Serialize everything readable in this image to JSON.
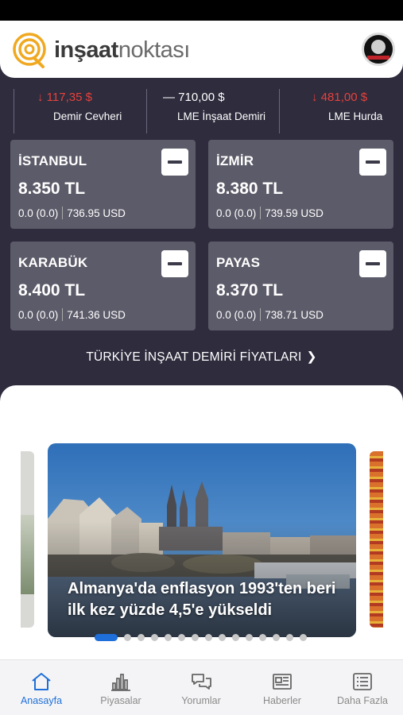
{
  "header": {
    "logo_bold": "inşaat",
    "logo_light": "noktası"
  },
  "ticker": [
    {
      "value": "117,35 $",
      "label": "Demir Cevheri",
      "direction": "down",
      "arrow": "↓"
    },
    {
      "value": "710,00 $",
      "label": "LME İnşaat Demiri",
      "direction": "flat",
      "arrow": "—"
    },
    {
      "value": "481,00 $",
      "label": "LME Hurda",
      "direction": "down",
      "arrow": "↓"
    }
  ],
  "cards": [
    {
      "city": "İSTANBUL",
      "price": "8.350 TL",
      "change": "0.0 (0.0)",
      "usd": "736.95 USD"
    },
    {
      "city": "İZMİR",
      "price": "8.380 TL",
      "change": "0.0 (0.0)",
      "usd": "739.59 USD"
    },
    {
      "city": "KARABÜK",
      "price": "8.400 TL",
      "change": "0.0 (0.0)",
      "usd": "741.36 USD"
    },
    {
      "city": "PAYAS",
      "price": "8.370 TL",
      "change": "0.0 (0.0)",
      "usd": "738.71 USD"
    }
  ],
  "prices_link": "TÜRKİYE İNŞAAT DEMİRİ FİYATLARI",
  "carousel": {
    "title": "Almanya'da enflasyon 1993'ten beri ilk kez yüzde 4,5'e yükseldi",
    "dot_count": 16,
    "active_index": 0
  },
  "nav": [
    {
      "label": "Anasayfa",
      "icon": "home-icon",
      "active": true
    },
    {
      "label": "Piyasalar",
      "icon": "chart-icon",
      "active": false
    },
    {
      "label": "Yorumlar",
      "icon": "comments-icon",
      "active": false
    },
    {
      "label": "Haberler",
      "icon": "news-icon",
      "active": false
    },
    {
      "label": "Daha Fazla",
      "icon": "more-icon",
      "active": false
    }
  ],
  "colors": {
    "accent": "#1e6fd9",
    "down": "#e8413c",
    "background": "#2e2c3d",
    "card": "#5c5b69",
    "logo": "#f0a820"
  }
}
